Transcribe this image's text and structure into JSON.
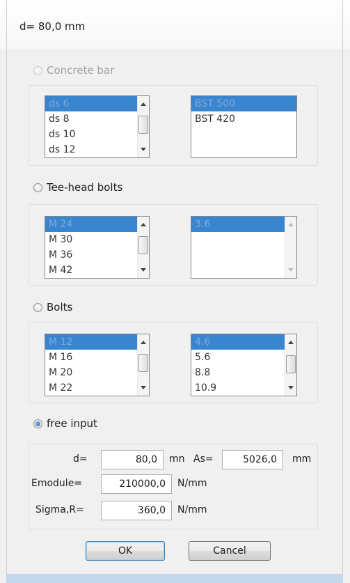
{
  "window": {
    "title": "d= 80,0 mm"
  },
  "sections": {
    "concrete": {
      "label": "Concrete bar",
      "sizes": [
        "ds 6",
        "ds 8",
        "ds 10",
        "ds 12"
      ],
      "grades": [
        "BST 500",
        "BST 420"
      ]
    },
    "tee": {
      "label": "Tee-head bolts",
      "sizes": [
        "M 24",
        "M 30",
        "M 36",
        "M 42"
      ],
      "grades": [
        "3.6"
      ]
    },
    "bolts": {
      "label": "Bolts",
      "sizes": [
        "M 12",
        "M 16",
        "M 20",
        "M 22"
      ],
      "grades": [
        "4.6",
        "5.6",
        "8.8",
        "10.9"
      ]
    },
    "free": {
      "label": "free input",
      "d_label": "d=",
      "d_value": "80,0",
      "d_unit": "mn",
      "as_label": "As=",
      "as_value": "5026,0",
      "as_unit": "mm",
      "e_label": "Emodule=",
      "e_value": "210000,0",
      "e_unit": "N/mm",
      "s_label": "Sigma,R=",
      "s_value": "360,0",
      "s_unit": "N/mm"
    }
  },
  "buttons": {
    "ok": "OK",
    "cancel": "Cancel"
  }
}
